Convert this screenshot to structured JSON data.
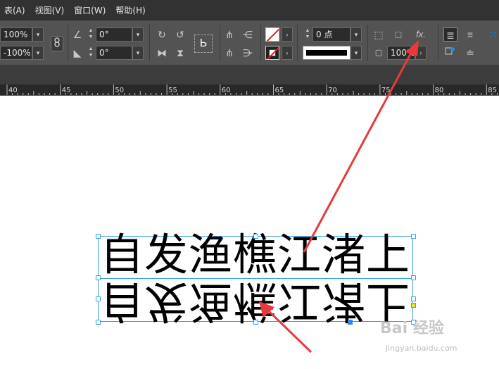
{
  "menu": [
    "表(A)",
    "视图(V)",
    "窗口(W)",
    "帮助(H)"
  ],
  "control": {
    "scale_x": "100%",
    "scale_y": "-100%",
    "rotate": "0°",
    "shear": "0°",
    "stroke_weight": "0 点",
    "opacity": "100%",
    "fx_label": "fx.",
    "chain_icon": "chain-link-icon"
  },
  "ruler": [
    "40",
    "45",
    "50",
    "55",
    "60",
    "65",
    "70",
    "75",
    "80",
    "85"
  ],
  "canvas": {
    "text": "自发渔樵江渚上"
  },
  "watermark": {
    "logo": "Bai 经验",
    "url": "jingyan.baidu.com"
  },
  "colors": {
    "arrow": "#e83a3a",
    "selection": "#3aa1e8"
  }
}
